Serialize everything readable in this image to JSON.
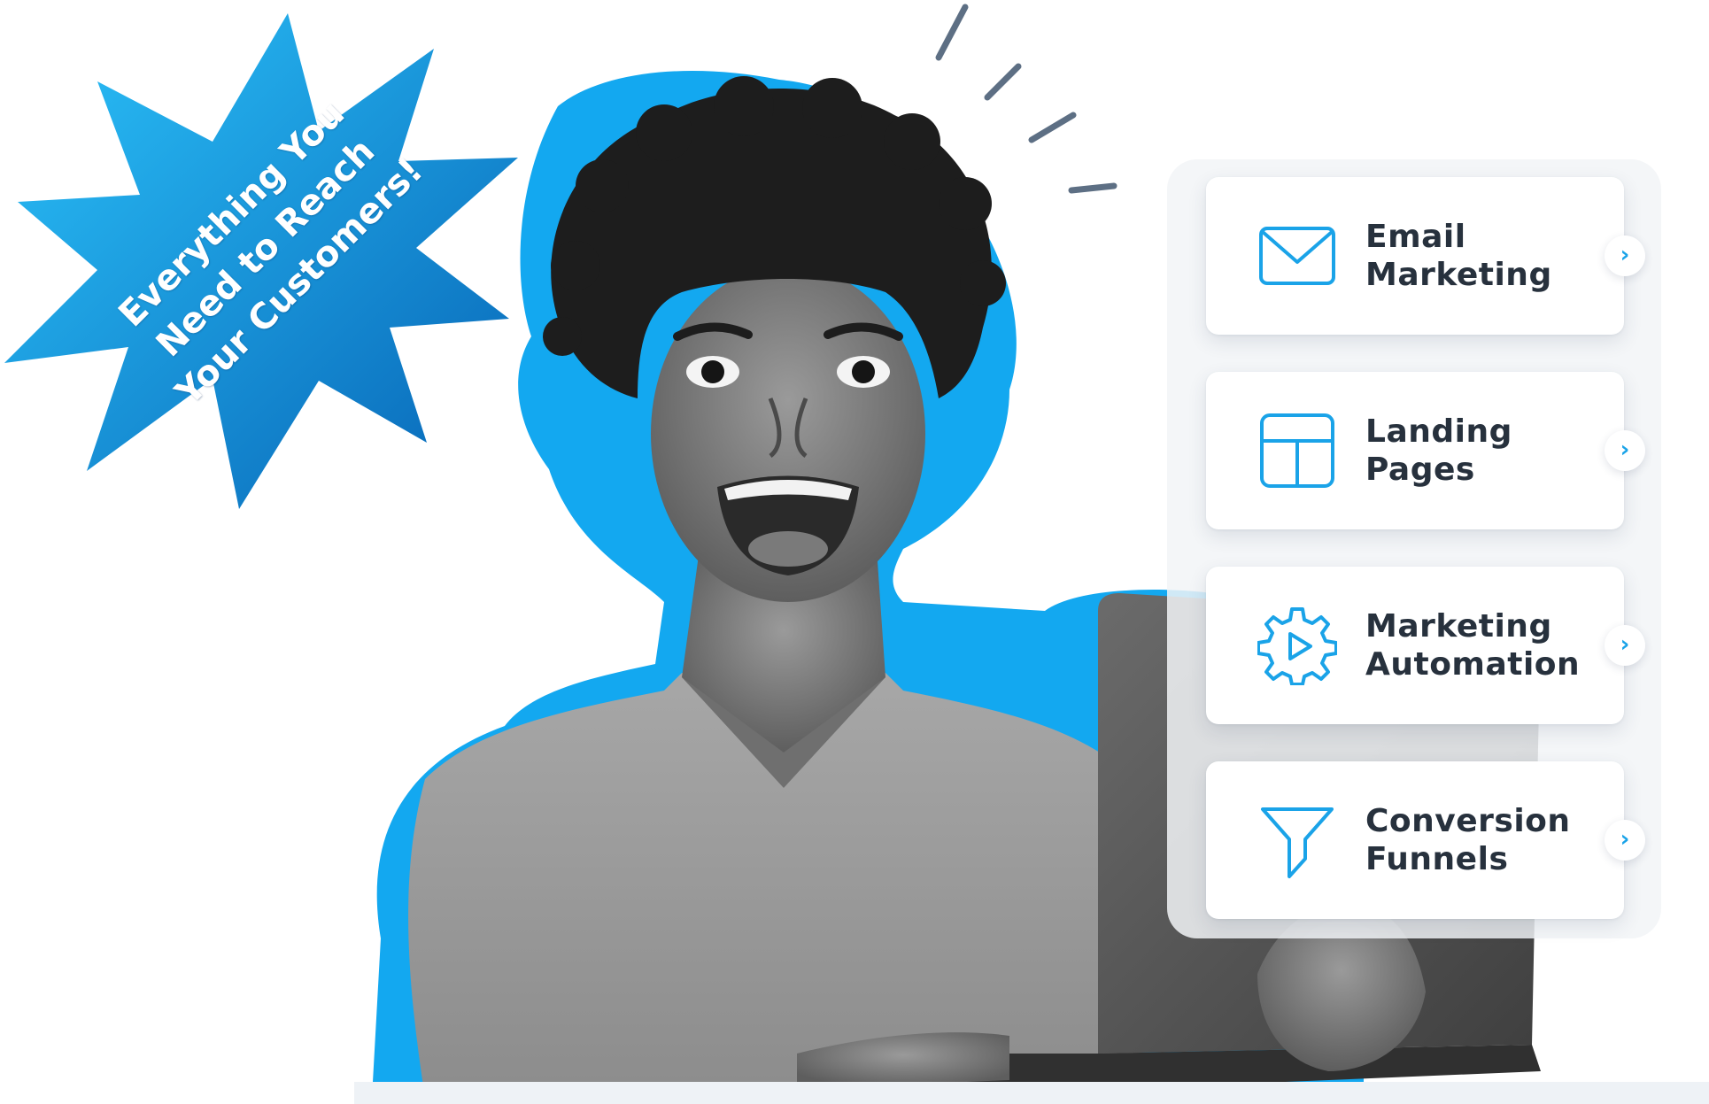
{
  "starburst": {
    "lines": [
      "Everything You",
      "Need to Reach",
      "Your Customers!"
    ],
    "color_light": "#24b9f5",
    "color_dark": "#0a70c2"
  },
  "features": [
    {
      "line1": "Email",
      "line2": "Marketing",
      "icon": "envelope-icon",
      "chevron": "›"
    },
    {
      "line1": "Landing",
      "line2": "Pages",
      "icon": "page-layout-icon",
      "chevron": "›"
    },
    {
      "line1": "Marketing",
      "line2": "Automation",
      "icon": "gear-play-icon",
      "chevron": "›"
    },
    {
      "line1": "Conversion",
      "line2": "Funnels",
      "icon": "funnel-icon",
      "chevron": "›"
    }
  ],
  "theme": {
    "accent": "#1aa3e8",
    "outline_blue": "#13a8f0",
    "card_text": "#27313d",
    "dash_color": "#5d6f84"
  }
}
